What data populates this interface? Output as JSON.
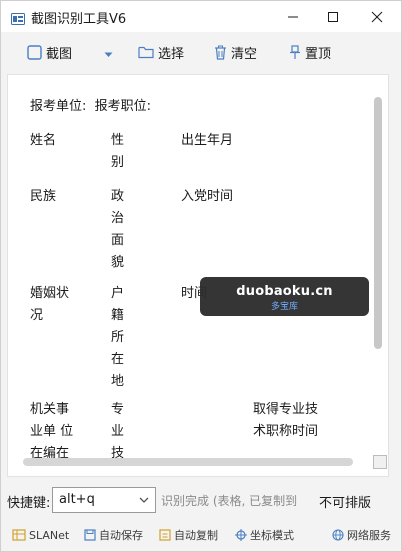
{
  "window": {
    "title": "截图识别工具V6"
  },
  "toolbar": {
    "capture_label": "截图",
    "select_label": "选择",
    "clear_label": "清空",
    "pin_label": "置顶"
  },
  "content": {
    "header_line": "报考单位:  报考职位:",
    "rows": [
      {
        "c1": "姓名",
        "c2": "性\n别",
        "c3": "出生年月",
        "c4": ""
      },
      {
        "c1": "民族",
        "c2": "政\n治\n面\n貌",
        "c3": "入党时间",
        "c4": ""
      },
      {
        "c1": "婚姻状\n况",
        "c2": "户\n籍\n所\n在\n地",
        "c3": "时间",
        "c4": ""
      },
      {
        "c1": "机关事\n业单 位\n在编在",
        "c2": "专\n业\n技",
        "c3": "",
        "c4": "取得专业技\n术职称时间"
      }
    ]
  },
  "watermark": {
    "main": "duobaoku.cn",
    "sub": "多宝库"
  },
  "options": {
    "hotkey_label": "快捷键:",
    "hotkey_value": "alt+q",
    "status_text": "识别完成 (表格, 已复制到",
    "no_layout_label": "不可排版"
  },
  "statusbar": {
    "slanet": "SLANet",
    "autosave": "自动保存",
    "autocopy": "自动复制",
    "coord_mode": "坐标模式",
    "network": "网络服务"
  },
  "colors": {
    "icon_blue": "#4a7fc1",
    "icon_gold": "#d2a12a",
    "watermark_bg": "#2b2b2b",
    "watermark_sub": "#6aa8ff"
  }
}
